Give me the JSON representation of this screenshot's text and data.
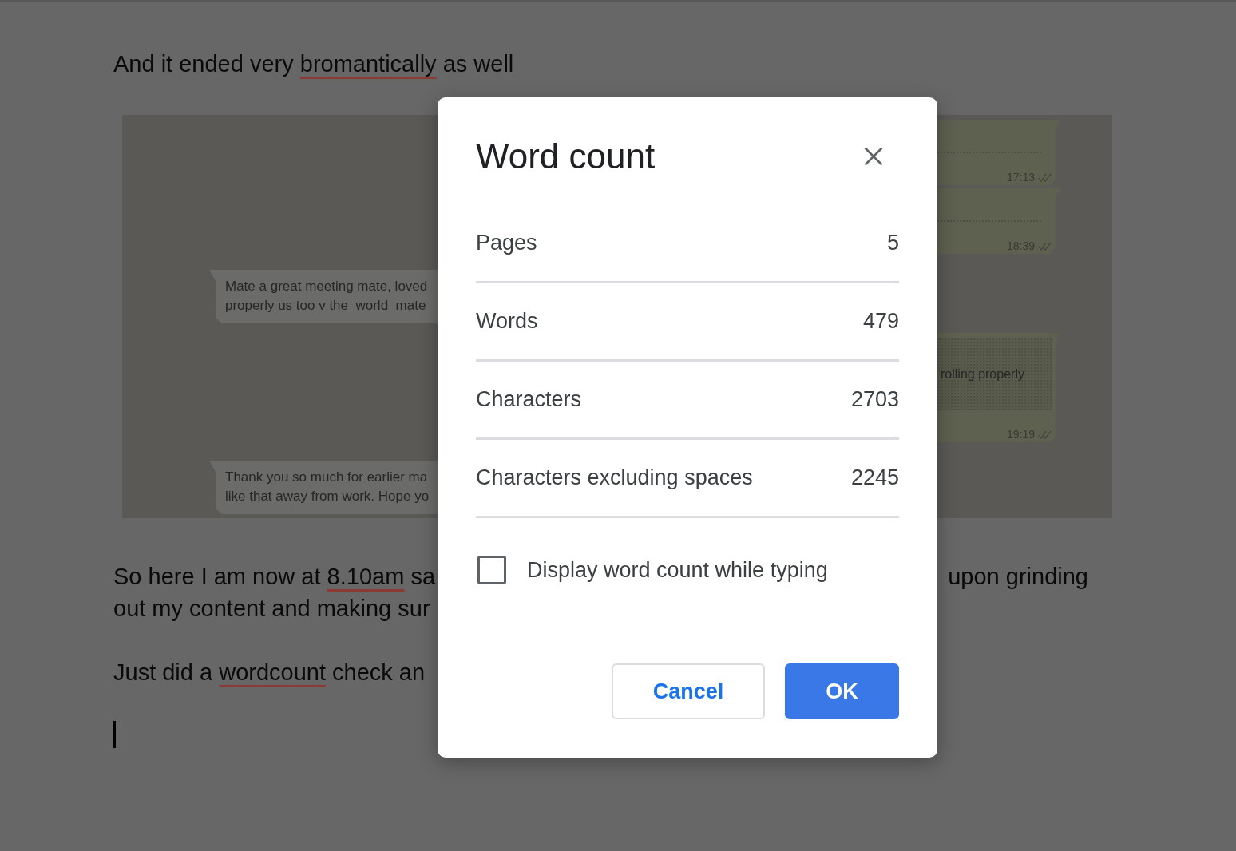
{
  "document": {
    "paragraphs": [
      {
        "kind": "text",
        "lines": [
          {
            "left": [
              {
                "text": "And it ended very ",
                "misspelled": false
              },
              {
                "text": "bromantically",
                "misspelled": true
              },
              {
                "text": " as well",
                "misspelled": false
              }
            ]
          }
        ]
      },
      {
        "kind": "chat_screenshot",
        "incoming": [
          {
            "lines": [
              "Mate a great meeting mate, loved",
              "properly us too v the  world  mate"
            ]
          },
          {
            "lines": [
              "Thank you so much for earlier ma",
              "like that away from work. Hope yo"
            ]
          }
        ],
        "outgoing": [
          {
            "time": "17:13"
          },
          {
            "time": "18:39"
          },
          {
            "quote": "rolling properly",
            "time": "19:19"
          }
        ]
      },
      {
        "kind": "text",
        "lines": [
          {
            "left": [
              {
                "text": "So here I am now at ",
                "misspelled": false
              },
              {
                "text": "8.10am",
                "misspelled": true
              },
              {
                "text": " sa",
                "misspelled": false
              }
            ],
            "right": [
              {
                "text": "upon grinding",
                "misspelled": false
              }
            ]
          },
          {
            "left": [
              {
                "text": "out my content and making sur",
                "misspelled": false
              }
            ]
          }
        ]
      },
      {
        "kind": "text",
        "lines": [
          {
            "left": [
              {
                "text": "Just did a ",
                "misspelled": false
              },
              {
                "text": "wordcount",
                "misspelled": true
              },
              {
                "text": " check an",
                "misspelled": false
              }
            ]
          }
        ]
      }
    ]
  },
  "dialog": {
    "title": "Word count",
    "stats": [
      {
        "label": "Pages",
        "value": "5"
      },
      {
        "label": "Words",
        "value": "479"
      },
      {
        "label": "Characters",
        "value": "2703"
      },
      {
        "label": "Characters excluding spaces",
        "value": "2245"
      }
    ],
    "display_while_typing": {
      "label": "Display word count while typing",
      "checked": false
    },
    "buttons": [
      {
        "label": "Cancel",
        "kind": "secondary"
      },
      {
        "label": "OK",
        "kind": "primary"
      }
    ]
  }
}
